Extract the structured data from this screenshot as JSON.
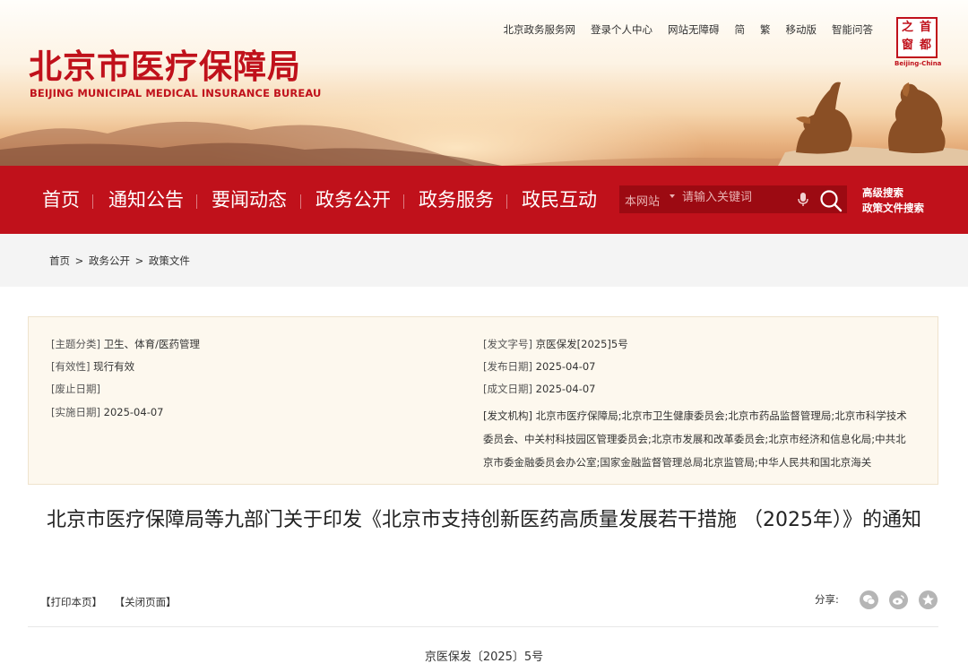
{
  "header": {
    "logo_cn": "北京市医疗保障局",
    "logo_en": "BEIJING MUNICIPAL MEDICAL INSURANCE BUREAU",
    "top_links": [
      "北京政务服务网",
      "登录个人中心",
      "网站无障碍",
      "简",
      "繁",
      "移动版",
      "智能问答"
    ],
    "seal_chars": [
      "首",
      "都",
      "之",
      "窗"
    ],
    "seal_en": "Beijing-China"
  },
  "nav": {
    "items": [
      "首页",
      "通知公告",
      "要闻动态",
      "政务公开",
      "政务服务",
      "政民互动"
    ],
    "search_scope": "本网站",
    "search_placeholder": "请输入关键词",
    "advanced_search": "高级搜索",
    "policy_search": "政策文件搜索"
  },
  "breadcrumb": {
    "items": [
      "首页",
      "政务公开",
      "政策文件"
    ],
    "separator": ">"
  },
  "info": {
    "topic": {
      "key": "[主题分类]",
      "value": "卫生、体育/医药管理"
    },
    "validity": {
      "key": "[有效性]",
      "value": "现行有效"
    },
    "repeal_date": {
      "key": "[废止日期]",
      "value": ""
    },
    "effective_date": {
      "key": "[实施日期]",
      "value": "2025-04-07"
    },
    "doc_number": {
      "key": "[发文字号]",
      "value": "京医保发[2025]5号"
    },
    "publish_date": {
      "key": "[发布日期]",
      "value": "2025-04-07"
    },
    "written_date": {
      "key": "[成文日期]",
      "value": "2025-04-07"
    },
    "issuing_orgs": {
      "key": "[发文机构]",
      "value": "北京市医疗保障局;北京市卫生健康委员会;北京市药品监督管理局;北京市科学技术委员会、中关村科技园区管理委员会;北京市发展和改革委员会;北京市经济和信息化局;中共北京市委金融委员会办公室;国家金融监督管理总局北京监管局;中华人民共和国北京海关"
    }
  },
  "document": {
    "title": "北京市医疗保障局等九部门关于印发《北京市支持创新医药高质量发展若干措施 （2025年）》的通知",
    "print_label": "【打印本页】",
    "close_label": "【关闭页面】",
    "share_label": "分享:",
    "share_icons": [
      "wechat-icon",
      "weibo-icon",
      "qzone-icon"
    ],
    "doc_number_line": "京医保发〔2025〕5号"
  },
  "colors": {
    "brand_red": "#c0111b",
    "info_bg": "#fdf8ee",
    "crumb_bg": "#f4f4f4"
  }
}
